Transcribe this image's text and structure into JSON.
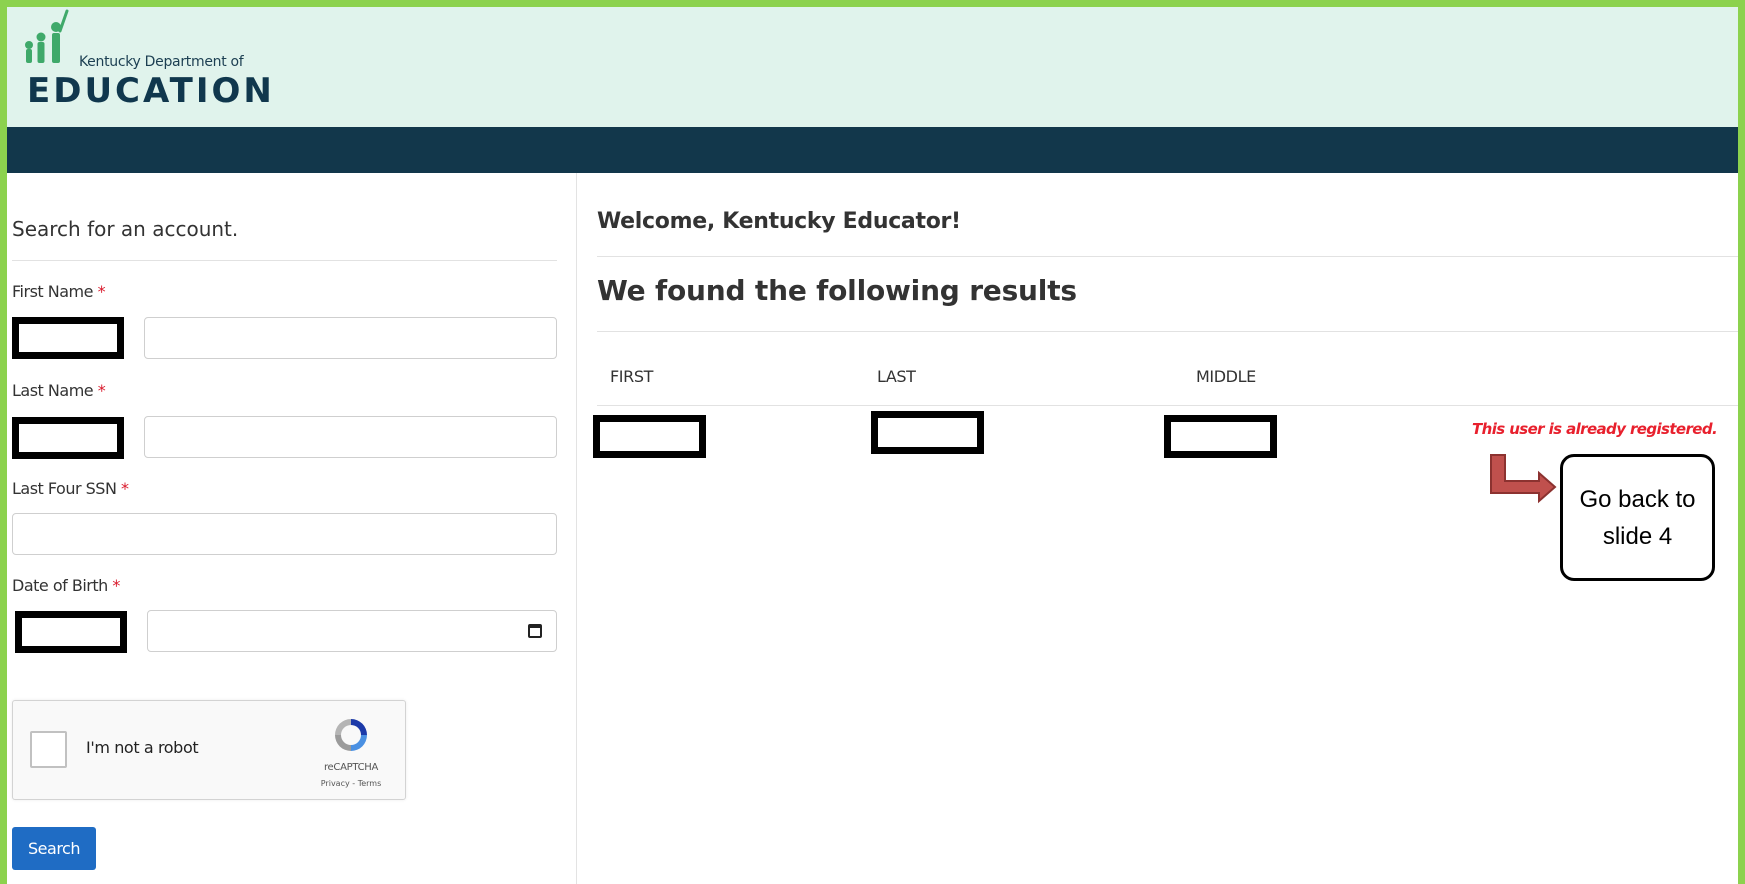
{
  "brand": {
    "small_text": "Kentucky Department of",
    "big_text": "EDUCATION"
  },
  "search_panel": {
    "title": "Search for an account.",
    "first_name_label": "First Name",
    "last_name_label": "Last Name",
    "ssn_label": "Last Four SSN",
    "dob_label": "Date of Birth",
    "required_marker": "*",
    "captcha": {
      "label": "I'm not a robot",
      "brand": "reCAPTCHA",
      "links": "Privacy - Terms"
    },
    "search_button": "Search"
  },
  "results": {
    "welcome": "Welcome, Kentucky Educator!",
    "title": "We found the following results",
    "columns": [
      "FIRST",
      "LAST",
      "MIDDLE"
    ],
    "status_message": "This user is already registered."
  },
  "annotation": {
    "callout_text": "Go back to slide 4"
  },
  "colors": {
    "frame_border": "#8cd24e",
    "header_bg": "#e0f3ec",
    "navbar_bg": "#12374b",
    "button_bg": "#1f6cc4",
    "error_text": "#e8202d",
    "arrow": "#c0504d"
  },
  "icons": {
    "logo": "kde-figures-logo",
    "calendar": "calendar-icon",
    "recaptcha": "recaptcha-icon",
    "arrow": "bent-arrow-icon"
  }
}
